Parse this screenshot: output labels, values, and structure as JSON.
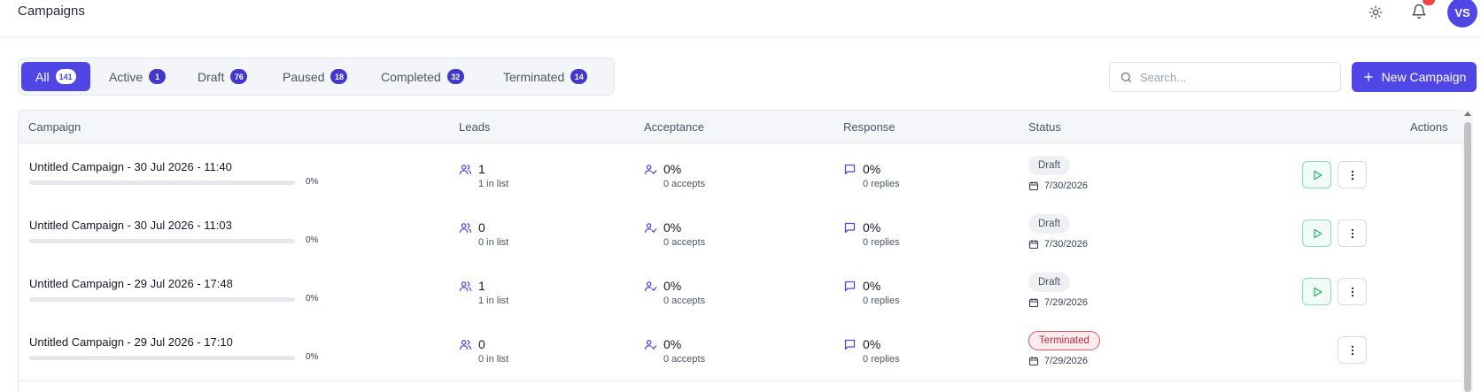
{
  "header": {
    "title": "Campaigns",
    "avatar_initials": "VS",
    "icons": {
      "theme": "sun-icon",
      "notifications": "bell-icon"
    }
  },
  "tabs": [
    {
      "label": "All",
      "count": "141",
      "active": true
    },
    {
      "label": "Active",
      "count": "1"
    },
    {
      "label": "Draft",
      "count": "76"
    },
    {
      "label": "Paused",
      "count": "18"
    },
    {
      "label": "Completed",
      "count": "32"
    },
    {
      "label": "Terminated",
      "count": "14"
    }
  ],
  "search": {
    "placeholder": "Search..."
  },
  "new_campaign": {
    "label": "New Campaign"
  },
  "table": {
    "columns": [
      "Campaign",
      "Leads",
      "Acceptance",
      "Response",
      "Status",
      "Actions"
    ],
    "rows": [
      {
        "name": "Untitled Campaign - 30 Jul 2026 - 11:40",
        "progress": "0%",
        "progress_fraction": 0,
        "leads": "1",
        "leads_sub": "1 in list",
        "acceptance": "0%",
        "acceptance_sub": "0 accepts",
        "response": "0%",
        "response_sub": "0 replies",
        "status": "Draft",
        "date": "7/30/2026",
        "can_start": true
      },
      {
        "name": "Untitled Campaign - 30 Jul 2026 - 11:03",
        "progress": "0%",
        "progress_fraction": 0,
        "leads": "0",
        "leads_sub": "0 in list",
        "acceptance": "0%",
        "acceptance_sub": "0 accepts",
        "response": "0%",
        "response_sub": "0 replies",
        "status": "Draft",
        "date": "7/30/2026",
        "can_start": true
      },
      {
        "name": "Untitled Campaign - 29 Jul 2026 - 17:48",
        "progress": "0%",
        "progress_fraction": 0,
        "leads": "1",
        "leads_sub": "1 in list",
        "acceptance": "0%",
        "acceptance_sub": "0 accepts",
        "response": "0%",
        "response_sub": "0 replies",
        "status": "Draft",
        "date": "7/29/2026",
        "can_start": true
      },
      {
        "name": "Untitled Campaign - 29 Jul 2026 - 17:10",
        "progress": "0%",
        "progress_fraction": 0,
        "leads": "0",
        "leads_sub": "0 in list",
        "acceptance": "0%",
        "acceptance_sub": "0 accepts",
        "response": "0%",
        "response_sub": "0 replies",
        "status": "Terminated",
        "date": "7/29/2026",
        "can_start": false
      }
    ]
  },
  "colors": {
    "accent": "#4f46e5",
    "play_border": "#86e0b0",
    "terminated": "#c0283c",
    "badge": "#ef4444"
  }
}
